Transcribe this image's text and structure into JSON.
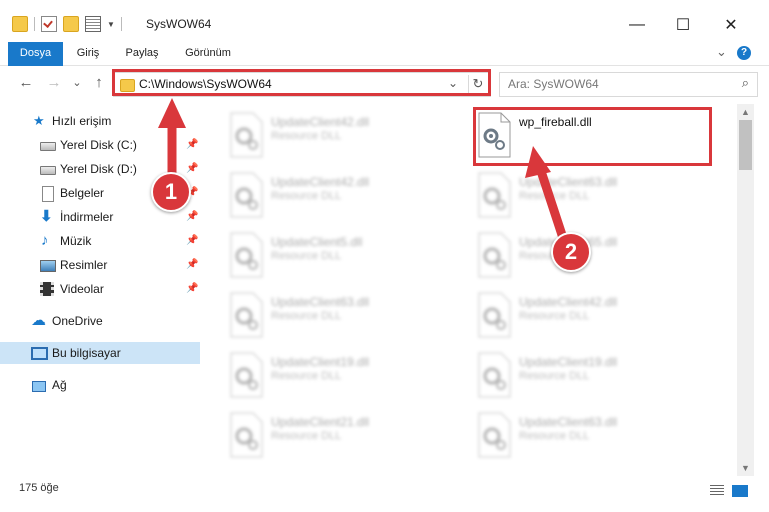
{
  "window": {
    "title": "SysWOW64",
    "minimize_glyph": "—",
    "maximize_glyph": "☐",
    "close_glyph": "✕"
  },
  "ribbon": {
    "tabs": [
      "Dosya",
      "Giriş",
      "Paylaş",
      "Görünüm"
    ],
    "expand_glyph": "⌄",
    "help_glyph": "?"
  },
  "navigation": {
    "back_glyph": "←",
    "forward_glyph": "→",
    "recent_glyph": "⌄",
    "up_glyph": "↑",
    "address": "C:\\Windows\\SysWOW64",
    "address_dropdown_glyph": "⌄",
    "refresh_glyph": "↻",
    "search_placeholder": "Ara: SysWOW64",
    "search_glyph": "⌕"
  },
  "sidebar": {
    "items": [
      {
        "label": "Hızlı erişim",
        "icon": "star-icon",
        "pinned": false
      },
      {
        "label": "Yerel Disk (C:)",
        "icon": "drive-icon",
        "pinned": true
      },
      {
        "label": "Yerel Disk (D:)",
        "icon": "drive-icon",
        "pinned": true
      },
      {
        "label": "Belgeler",
        "icon": "documents-icon",
        "pinned": true
      },
      {
        "label": "İndirmeler",
        "icon": "downloads-icon",
        "pinned": true
      },
      {
        "label": "Müzik",
        "icon": "music-icon",
        "pinned": true
      },
      {
        "label": "Resimler",
        "icon": "pictures-icon",
        "pinned": true
      },
      {
        "label": "Videolar",
        "icon": "videos-icon",
        "pinned": true
      },
      {
        "label": "OneDrive",
        "icon": "onedrive-icon",
        "pinned": false
      },
      {
        "label": "Bu bilgisayar",
        "icon": "this-pc-icon",
        "pinned": false,
        "selected": true
      },
      {
        "label": "Ağ",
        "icon": "network-icon",
        "pinned": false
      }
    ],
    "pin_glyph": "📌"
  },
  "files": {
    "left_column": [
      {
        "name": "UpdateClient42.dll",
        "type": "Resource DLL"
      },
      {
        "name": "UpdateClient42.dll",
        "type": "Resource DLL"
      },
      {
        "name": "UpdateClient5.dll",
        "type": "Resource DLL"
      },
      {
        "name": "UpdateClient63.dll",
        "type": "Resource DLL"
      },
      {
        "name": "UpdateClient19.dll",
        "type": "Resource DLL"
      },
      {
        "name": "UpdateClient21.dll",
        "type": "Resource DLL"
      }
    ],
    "right_column": [
      {
        "name": "wp_fireball.dll",
        "type": "",
        "highlighted": true
      },
      {
        "name": "UpdateClient63.dll",
        "type": "Resource DLL"
      },
      {
        "name": "UpdateClient65.dll",
        "type": "Resource DLL"
      },
      {
        "name": "UpdateClient42.dll",
        "type": "Resource DLL"
      },
      {
        "name": "UpdateClient19.dll",
        "type": "Resource DLL"
      },
      {
        "name": "UpdateClient63.dll",
        "type": "Resource DLL"
      }
    ]
  },
  "status": {
    "item_count": "175 öğe"
  },
  "annotations": {
    "callout_1": "1",
    "callout_2": "2",
    "color": "#d9373b"
  },
  "colors": {
    "accent": "#1979ca",
    "selection": "#cce4f7",
    "highlight": "#d9373b"
  }
}
